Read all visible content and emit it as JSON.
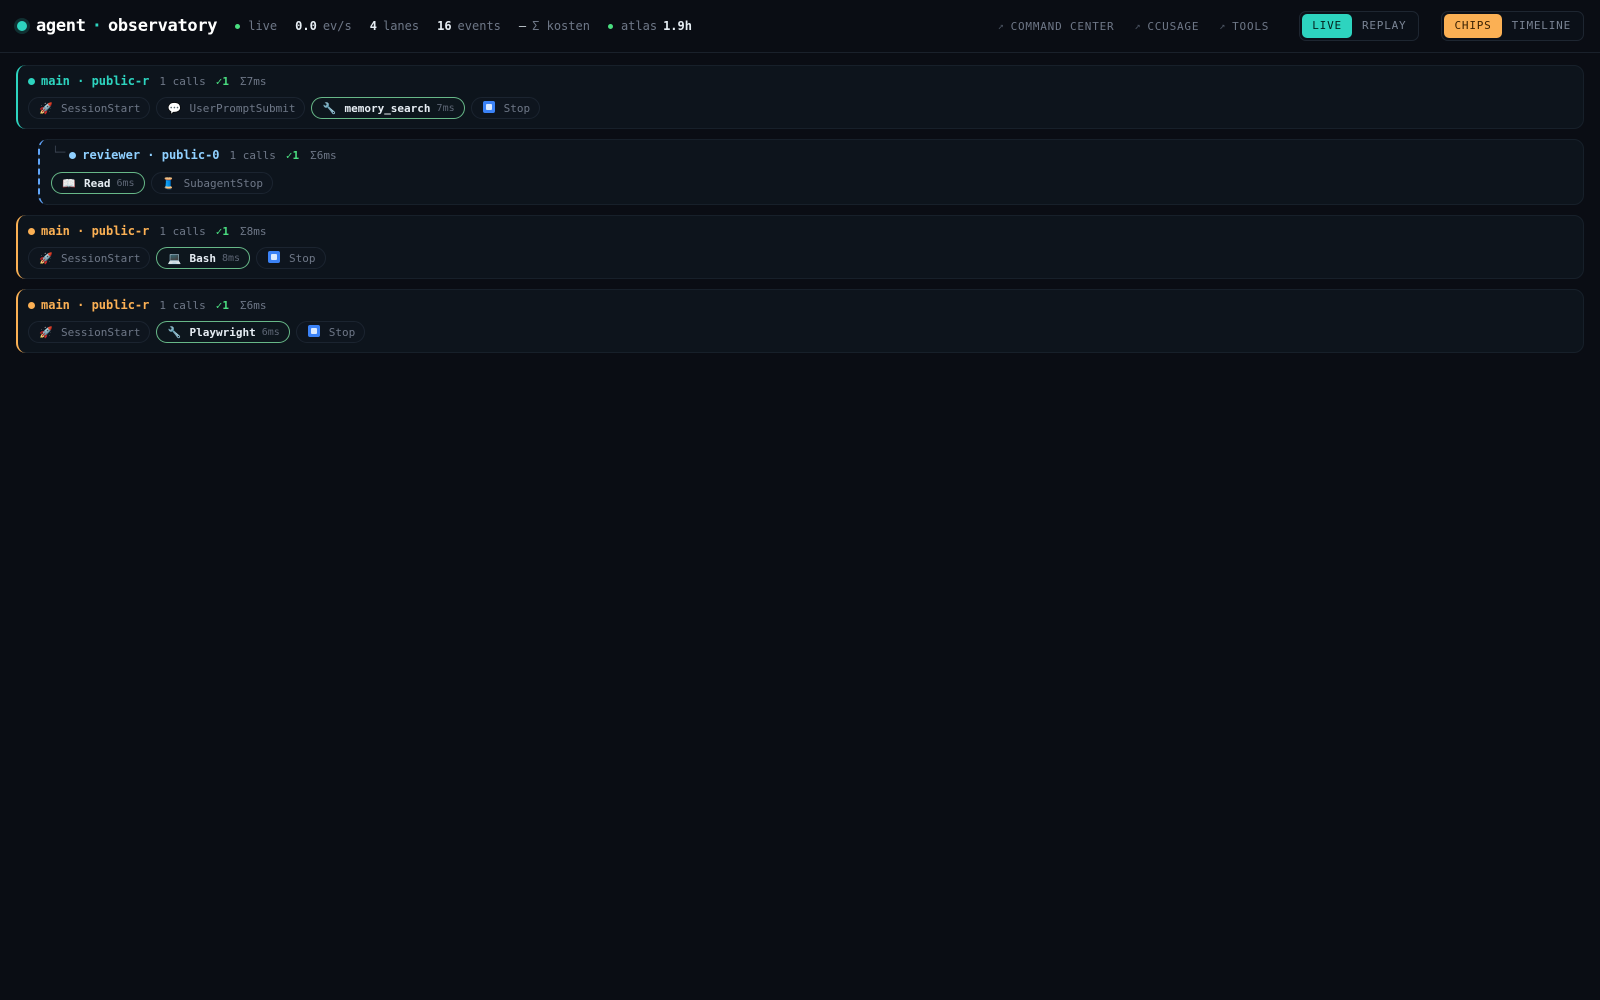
{
  "header": {
    "brand_left": "agent",
    "brand_sep": "·",
    "brand_right": "observatory",
    "live_label": "live",
    "rate_value": "0.0",
    "rate_unit": "ev/s",
    "lanes_value": "4",
    "lanes_label": "lanes",
    "events_value": "16",
    "events_label": "events",
    "cost_dash": "—",
    "cost_label": "Σ kosten",
    "atlas_label": "atlas",
    "atlas_value": "1.9h",
    "nav": [
      "COMMAND CENTER",
      "CCUSAGE",
      "TOOLS"
    ],
    "mode_toggle": {
      "live": "LIVE",
      "replay": "REPLAY",
      "active": "LIVE"
    },
    "view_toggle": {
      "chips": "CHIPS",
      "timeline": "TIMELINE",
      "active": "CHIPS"
    }
  },
  "lanes": [
    {
      "kind": "main",
      "color": "#2dd4bf",
      "name": "main · public-r",
      "calls": "1 calls",
      "ok": "✓1",
      "sum": "Σ7ms",
      "chips": [
        {
          "icon": "rocket-icon",
          "label": "SessionStart",
          "tool": false,
          "ms": ""
        },
        {
          "icon": "speech-bubble-icon",
          "label": "UserPromptSubmit",
          "tool": false,
          "ms": ""
        },
        {
          "icon": "wrench-icon",
          "label": "memory_search",
          "tool": true,
          "ms": "7ms"
        },
        {
          "icon": "stop-icon",
          "label": "Stop",
          "tool": false,
          "ms": ""
        }
      ]
    },
    {
      "kind": "sub",
      "color": "#8fd0ff",
      "name": "reviewer · public-0",
      "calls": "1 calls",
      "ok": "✓1",
      "sum": "Σ6ms",
      "chips": [
        {
          "icon": "book-icon",
          "label": "Read",
          "tool": true,
          "ms": "6ms"
        },
        {
          "icon": "thread-spool-icon",
          "label": "SubagentStop",
          "tool": false,
          "ms": ""
        }
      ]
    },
    {
      "kind": "main",
      "color": "#fbb054",
      "name": "main · public-r",
      "calls": "1 calls",
      "ok": "✓1",
      "sum": "Σ8ms",
      "chips": [
        {
          "icon": "rocket-icon",
          "label": "SessionStart",
          "tool": false,
          "ms": ""
        },
        {
          "icon": "computer-icon",
          "label": "Bash",
          "tool": true,
          "ms": "8ms"
        },
        {
          "icon": "stop-icon",
          "label": "Stop",
          "tool": false,
          "ms": ""
        }
      ]
    },
    {
      "kind": "main",
      "color": "#fbb054",
      "name": "main · public-r",
      "calls": "1 calls",
      "ok": "✓1",
      "sum": "Σ6ms",
      "chips": [
        {
          "icon": "rocket-icon",
          "label": "SessionStart",
          "tool": false,
          "ms": ""
        },
        {
          "icon": "wrench-icon",
          "label": "Playwright",
          "tool": true,
          "ms": "6ms"
        },
        {
          "icon": "stop-icon",
          "label": "Stop",
          "tool": false,
          "ms": ""
        }
      ]
    }
  ]
}
